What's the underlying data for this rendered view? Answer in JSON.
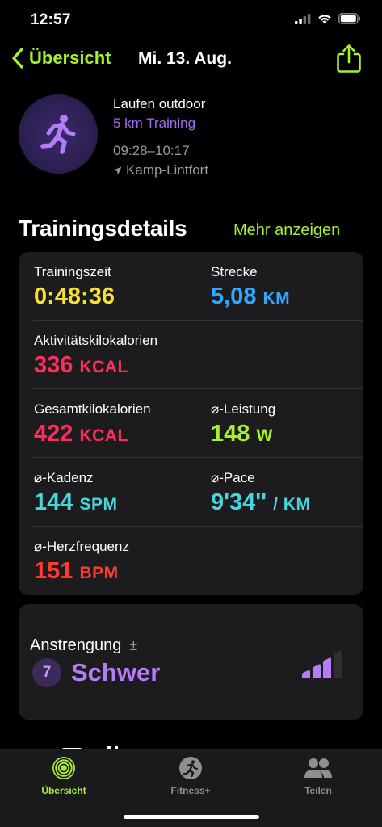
{
  "status": {
    "time": "12:57"
  },
  "nav": {
    "back_label": "Übersicht",
    "date": "Mi. 13. Aug."
  },
  "workout": {
    "title": "Laufen outdoor",
    "subtitle": "5 km Training",
    "time_range": "09:28–10:17",
    "location": "Kamp-Lintfort"
  },
  "details": {
    "heading": "Trainingsdetails",
    "more_label": "Mehr anzeigen",
    "metrics": {
      "duration": {
        "label": "Trainingszeit",
        "value": "0:48:36",
        "unit": ""
      },
      "distance": {
        "label": "Strecke",
        "value": "5,08",
        "unit": "KM"
      },
      "active_kcal": {
        "label": "Aktivitätskilokalorien",
        "value": "336",
        "unit": "KCAL"
      },
      "total_kcal": {
        "label": "Gesamtkilokalorien",
        "value": "422",
        "unit": "KCAL"
      },
      "power": {
        "label": "⌀-Leistung",
        "value": "148",
        "unit": "W"
      },
      "cadence": {
        "label": "⌀-Kadenz",
        "value": "144",
        "unit": "SPM"
      },
      "pace": {
        "label": "⌀-Pace",
        "value": "9'34''",
        "unit": "/ KM"
      },
      "heart_rate": {
        "label": "⌀-Herzfrequenz",
        "value": "151",
        "unit": "BPM"
      }
    }
  },
  "effort": {
    "title": "Anstrengung",
    "plus_minus": "±",
    "level": "7",
    "label": "Schwer"
  },
  "tabs": [
    {
      "label": "Übersicht",
      "icon": "activity-rings-icon",
      "active": true
    },
    {
      "label": "Fitness+",
      "icon": "fitness-plus-icon",
      "active": false
    },
    {
      "label": "Teilen",
      "icon": "people-icon",
      "active": false
    }
  ],
  "colors": {
    "accent": "#a6f02d",
    "duration": "#f6e035",
    "distance": "#2ea8ff",
    "calories": "#ff2d5a",
    "power": "#a6f02d",
    "cadence_pace": "#45d6de",
    "heart_rate": "#ff3b2f",
    "effort": "#b47cf5"
  }
}
